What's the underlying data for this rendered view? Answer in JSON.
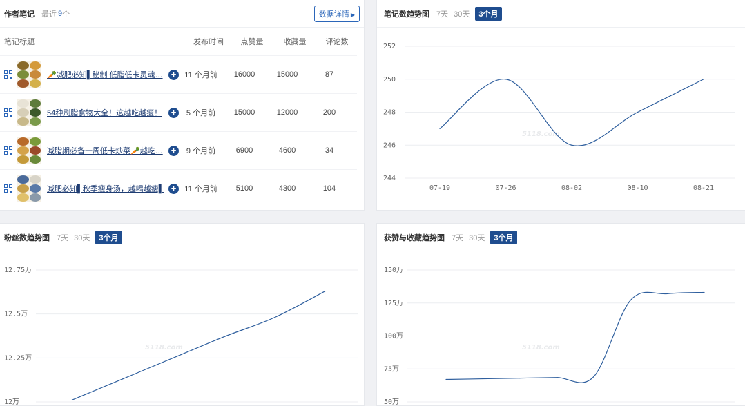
{
  "notes_panel": {
    "title": "作者笔记",
    "recent_label": "最近",
    "recent_count": "9",
    "unit": "个",
    "detail_button": "数据详情",
    "columns": [
      "笔记标题",
      "发布时间",
      "点赞量",
      "收藏量",
      "评论数"
    ],
    "rows": [
      {
        "title": "🥕减肥必知▌秘制 低脂低卡灵魂…",
        "time": "11 个月前",
        "likes": "16000",
        "favorites": "15000",
        "comments": "87",
        "thumb_colors": [
          "#8a6a2a",
          "#d49a3a",
          "#7a8d3a",
          "#c98a3c",
          "#a05a2c",
          "#d4b04a"
        ]
      },
      {
        "title": "54种刷脂食物大全！这越吃越瘦！",
        "time": "5 个月前",
        "likes": "15000",
        "favorites": "12000",
        "comments": "200",
        "thumb_colors": [
          "#e8e3d6",
          "#5e7c3a",
          "#d7cfb8",
          "#3c5a2a",
          "#c8b98a",
          "#7a9a4a"
        ]
      },
      {
        "title": "减脂期必备一周低卡炒菜🥕越吃…",
        "time": "9 个月前",
        "likes": "6900",
        "favorites": "4600",
        "comments": "34",
        "thumb_colors": [
          "#b86a2a",
          "#7a9a3a",
          "#d4a24a",
          "#9a4a2a",
          "#c49a3a",
          "#6a8a3a"
        ]
      },
      {
        "title": "减肥必知▌秋季瘦身汤，越喝越瘦▌",
        "time": "11 个月前",
        "likes": "5100",
        "favorites": "4300",
        "comments": "104",
        "thumb_colors": [
          "#4a6a9a",
          "#d8d4c8",
          "#c8a04a",
          "#5a7aa8",
          "#e0c06a",
          "#8a9aaa"
        ]
      }
    ]
  },
  "watermark": "5118.com",
  "tabs": [
    "7天",
    "30天",
    "3个月"
  ],
  "active_tab": "3个月",
  "accent_color": "#1f4d8f",
  "line_color": "#2f5f9e",
  "chart_data": [
    {
      "id": "notes_trend",
      "type": "line",
      "title": "笔记数趋势图",
      "x": [
        "07-19",
        "07-26",
        "08-02",
        "08-10",
        "08-21"
      ],
      "y": [
        247,
        250,
        246,
        248,
        250
      ],
      "yticks": [
        "244",
        "246",
        "248",
        "250",
        "252"
      ],
      "ylim": [
        244,
        252
      ],
      "grid": true
    },
    {
      "id": "fans_trend",
      "type": "line",
      "title": "粉丝数趋势图",
      "x": [],
      "y": [
        12.01,
        12.13,
        12.25,
        12.37,
        12.48,
        12.63
      ],
      "yticks": [
        "12万",
        "12.25万",
        "12.5万",
        "12.75万"
      ],
      "ylim": [
        12,
        12.75
      ],
      "grid": true
    },
    {
      "id": "likes_fav_trend",
      "type": "line",
      "title": "获赞与收藏趋势图",
      "x": [],
      "y": [
        67,
        67.5,
        68,
        68.5,
        69,
        127,
        132,
        133
      ],
      "yticks": [
        "50万",
        "75万",
        "100万",
        "125万",
        "150万"
      ],
      "ylim": [
        50,
        150
      ],
      "grid": true
    }
  ]
}
